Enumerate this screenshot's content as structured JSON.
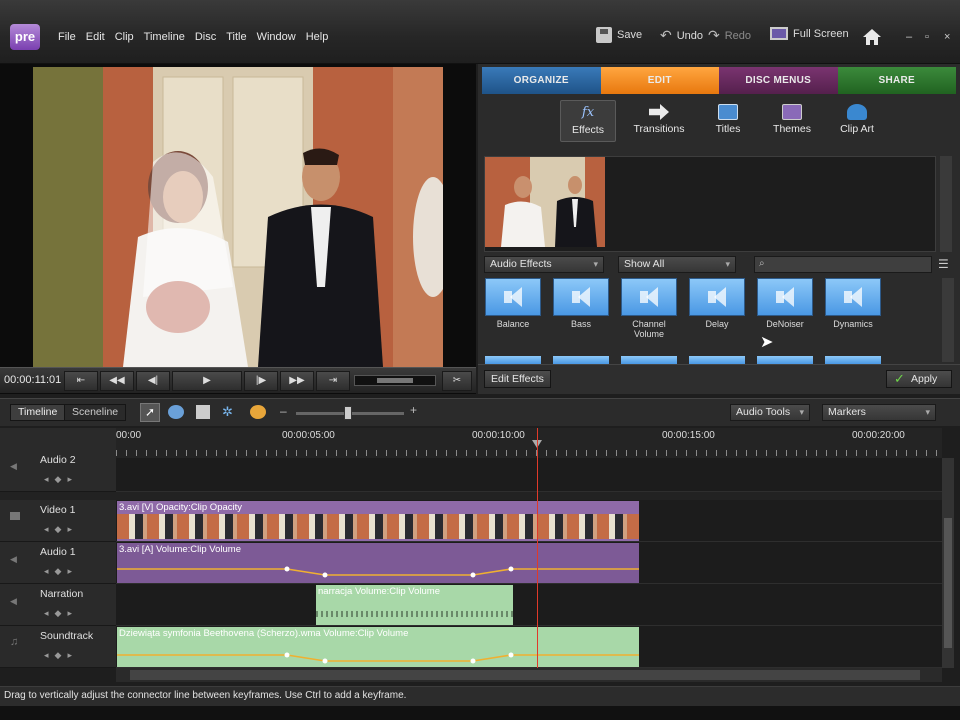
{
  "app": {
    "logo_text": "pre",
    "menu": [
      "File",
      "Edit",
      "Clip",
      "Timeline",
      "Disc",
      "Title",
      "Window",
      "Help"
    ],
    "toolbar": {
      "save_label": "Save",
      "undo_label": "Undo",
      "redo_label": "Redo",
      "fullscreen_label": "Full Screen"
    },
    "window_controls": [
      "–",
      "▫",
      "×"
    ]
  },
  "monitor": {
    "timecode": "00:00:11:01"
  },
  "panel": {
    "tabs": [
      "ORGANIZE",
      "EDIT",
      "DISC MENUS",
      "SHARE"
    ],
    "active_tab": "EDIT",
    "subtabs": [
      "Effects",
      "Transitions",
      "Titles",
      "Themes",
      "Clip Art"
    ],
    "active_subtab": "Effects",
    "category_dropdown": "Audio Effects",
    "filter_dropdown": "Show All",
    "search_placeholder": "",
    "effects": [
      {
        "name": "Balance"
      },
      {
        "name": "Bass"
      },
      {
        "name": "Channel Volume"
      },
      {
        "name": "Delay"
      },
      {
        "name": "DeNoiser"
      },
      {
        "name": "Dynamics"
      }
    ],
    "edit_effects_label": "Edit Effects",
    "apply_label": "Apply"
  },
  "timeline": {
    "view_tabs": [
      "Timeline",
      "Sceneline"
    ],
    "active_view": "Timeline",
    "audio_tools_label": "Audio Tools",
    "markers_label": "Markers",
    "ruler_labels": [
      "00:00",
      "00:00:05:00",
      "00:00:10:00",
      "00:00:15:00",
      "00:00:20:00"
    ],
    "tracks": [
      {
        "name": "Audio 2"
      },
      {
        "name": "Video 1"
      },
      {
        "name": "Audio 1"
      },
      {
        "name": "Narration"
      },
      {
        "name": "Soundtrack"
      }
    ],
    "clips": {
      "video": "3.avi [V]  Opacity:Clip Opacity",
      "audio": "3.avi [A]  Volume:Clip Volume",
      "narration": "narracja  Volume:Clip Volume",
      "soundtrack": "Dziewiąta symfonia Beethovena (Scherzo).wma  Volume:Clip Volume"
    }
  },
  "status": {
    "text": "Drag to vertically adjust the connector line between keyframes. Use Ctrl to add a keyframe."
  },
  "colors": {
    "organize": "#2f6aa6",
    "edit": "#f5901f",
    "disc_menus": "#6a2a62",
    "share": "#2e7a2e",
    "playhead": "#e03a2a",
    "effect_tile": "#5aaaf0"
  }
}
